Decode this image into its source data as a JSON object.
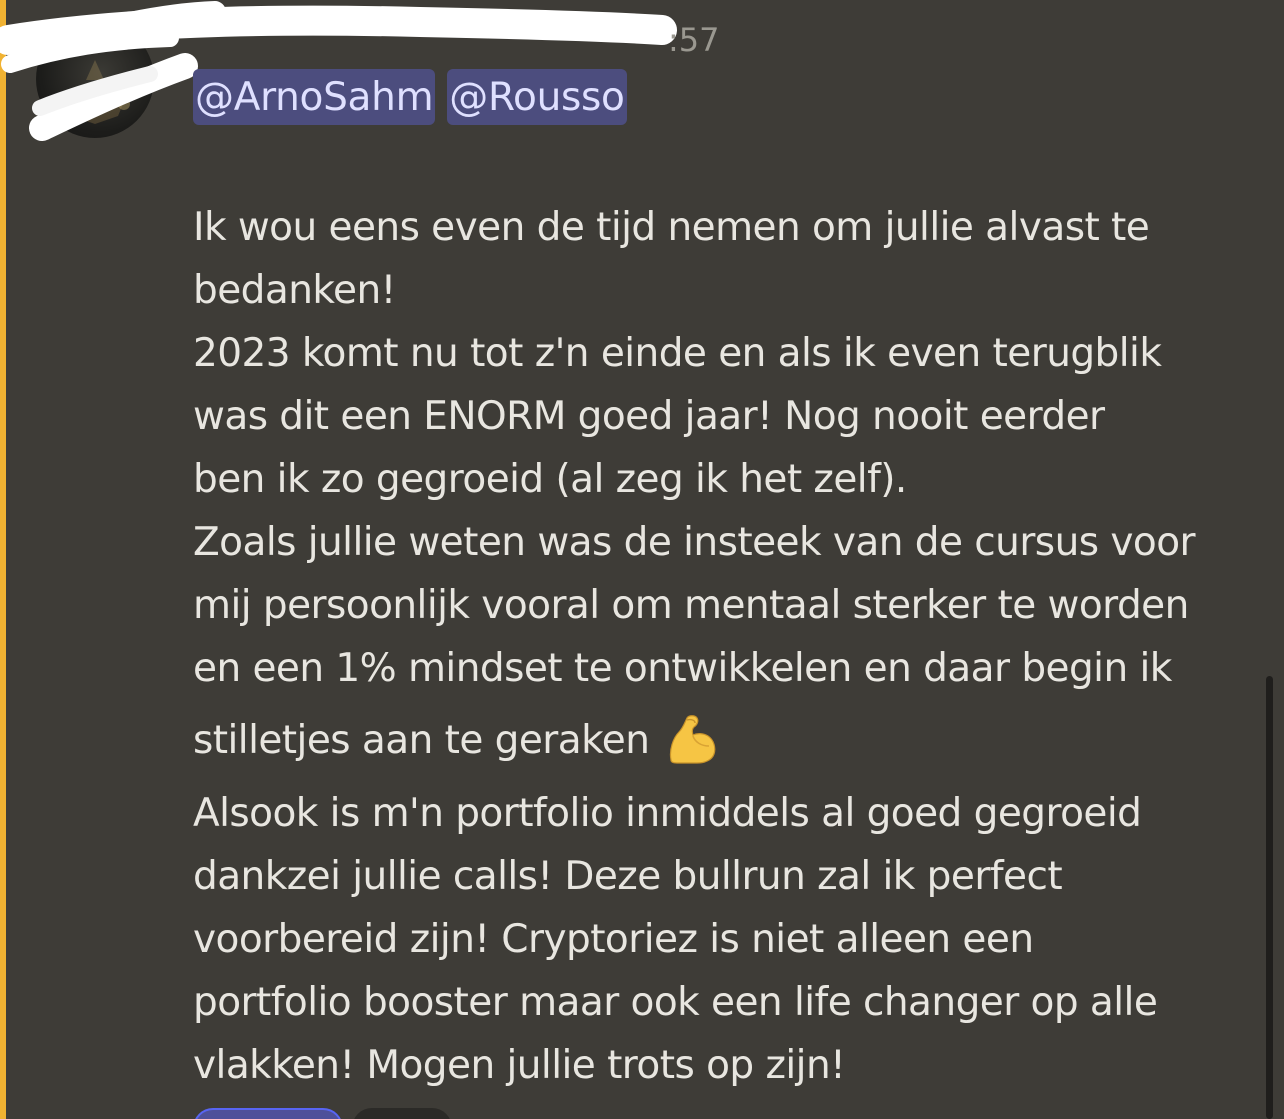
{
  "message": {
    "timestamp": ":57",
    "mentions": [
      "@ArnoSahm",
      "@Rousso"
    ],
    "lines": [
      "Ik wou eens even de tijd nemen om jullie alvast te",
      "bedanken!",
      "2023 komt nu tot z'n einde en als ik even terugblik",
      "was dit een ENORM goed jaar! Nog nooit eerder",
      "ben ik zo gegroeid (al zeg ik het zelf).",
      "Zoals jullie weten was de insteek van de cursus voor",
      "mij persoonlijk vooral om mentaal sterker te worden",
      "en een 1% mindset te ontwikkelen en daar begin ik",
      "stilletjes aan te geraken",
      "Alsook is m'n portfolio inmiddels al goed gegroeid",
      "dankzei jullie calls! Deze bullrun zal ik perfect",
      "voorbereid zijn! Cryptoriez is niet alleen een",
      "portfolio booster maar ook een life changer op alle",
      "vlakken! Mogen jullie trots op zijn!"
    ],
    "emoji": "flexed-biceps-icon"
  },
  "colors": {
    "background": "#3e3c37",
    "highlight_bar": "#f0b232",
    "mention_bg": "#4c4d7e",
    "mention_text": "#dfe0ff",
    "text": "#e8e6e0",
    "timestamp": "#9a9890"
  }
}
